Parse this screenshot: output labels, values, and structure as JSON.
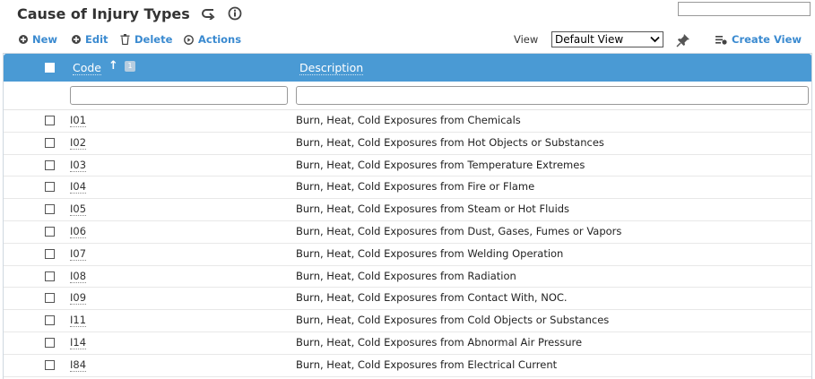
{
  "header": {
    "title": "Cause of Injury Types"
  },
  "toolbar": {
    "new_label": "New",
    "edit_label": "Edit",
    "delete_label": "Delete",
    "actions_label": "Actions",
    "view_label": "View",
    "view_selected": "Default View",
    "create_view_label": "Create View"
  },
  "grid": {
    "columns": {
      "code": "Code",
      "description": "Description"
    },
    "sort_badge": "1",
    "rows": [
      {
        "code": "I01",
        "description": "Burn, Heat, Cold Exposures from Chemicals"
      },
      {
        "code": "I02",
        "description": "Burn, Heat, Cold Exposures from Hot Objects or Substances"
      },
      {
        "code": "I03",
        "description": "Burn, Heat, Cold Exposures from Temperature Extremes"
      },
      {
        "code": "I04",
        "description": "Burn, Heat, Cold Exposures from Fire or Flame"
      },
      {
        "code": "I05",
        "description": "Burn, Heat, Cold Exposures from Steam or Hot Fluids"
      },
      {
        "code": "I06",
        "description": "Burn, Heat, Cold Exposures from Dust, Gases, Fumes or Vapors"
      },
      {
        "code": "I07",
        "description": "Burn, Heat, Cold Exposures from Welding Operation"
      },
      {
        "code": "I08",
        "description": "Burn, Heat, Cold Exposures from Radiation"
      },
      {
        "code": "I09",
        "description": "Burn, Heat, Cold Exposures from Contact With, NOC."
      },
      {
        "code": "I11",
        "description": "Burn, Heat, Cold Exposures from Cold Objects or Substances"
      },
      {
        "code": "I14",
        "description": "Burn, Heat, Cold Exposures from Abnormal Air Pressure"
      },
      {
        "code": "I84",
        "description": "Burn, Heat, Cold Exposures from Electrical Current"
      }
    ]
  },
  "colors": {
    "accent": "#3a8ad0",
    "header_bg": "#4a9ad4"
  }
}
